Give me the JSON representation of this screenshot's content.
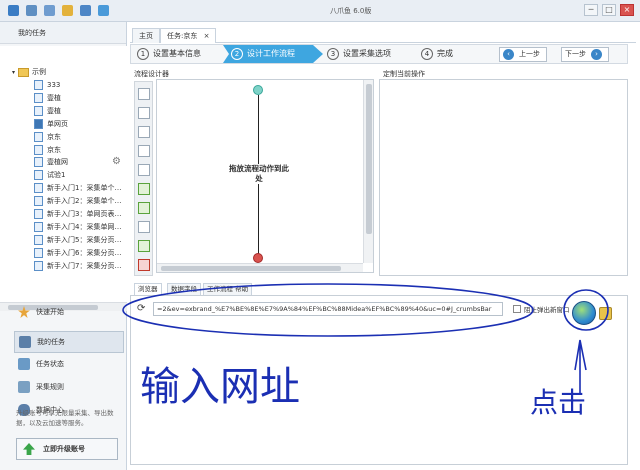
{
  "app": {
    "title": "八爪鱼 6.0版"
  },
  "window_buttons": [
    "─",
    "□",
    "×"
  ],
  "left_panel": {
    "header": "我的任务",
    "tree_root": "示例",
    "tree_items": [
      "333",
      "壹植",
      "壹植",
      "单网页",
      "京东",
      "京东",
      "壹植网",
      "试验1",
      "新手入门1：采集单个…",
      "新手入门2：采集单个…",
      "新手入门3：单网页表…",
      "新手入门4：采集单网…",
      "新手入门5：采集分页…",
      "新手入门6：采集分页…",
      "新手入门7：采集分页…"
    ],
    "nav": [
      {
        "label": "快速开始",
        "color": "#e7a53a"
      },
      {
        "label": "我的任务",
        "color": "#5b7fa8"
      },
      {
        "label": "任务状态",
        "color": "#6a9ac6"
      },
      {
        "label": "采集规则",
        "color": "#7aa0c2"
      },
      {
        "label": "数据中心",
        "color": "#5b7fa8"
      }
    ],
    "upgrade_text": "升级账号可享无限量采集、导出数据，以及云加速等服务。",
    "upgrade_button": "立即升级账号"
  },
  "tabs": [
    {
      "label": "主页"
    },
    {
      "label": "任务:京东",
      "close": "×"
    }
  ],
  "wizard": {
    "steps": [
      {
        "num": "1",
        "label": "设置基本信息"
      },
      {
        "num": "2",
        "label": "设计工作流程"
      },
      {
        "num": "3",
        "label": "设置采集选项"
      },
      {
        "num": "4",
        "label": "完成"
      }
    ],
    "prev_label": "上一步",
    "next_label": "下一步"
  },
  "designer": {
    "label": "流程设计器",
    "hint": "拖放流程动作到此处"
  },
  "config": {
    "label": "定制当前操作"
  },
  "browser": {
    "tabs": [
      "浏览器",
      "数据字段",
      "工作流程 帮助"
    ],
    "url": "=2&ev=exbrand_%E7%BE%8E%E7%9A%84%EF%BC%88Midea%EF%BC%89%40&uc=0#J_crumbsBar",
    "popup_label": "阻止弹出新窗口"
  },
  "annotations": {
    "input_url": "输入网址",
    "click": "点击"
  }
}
